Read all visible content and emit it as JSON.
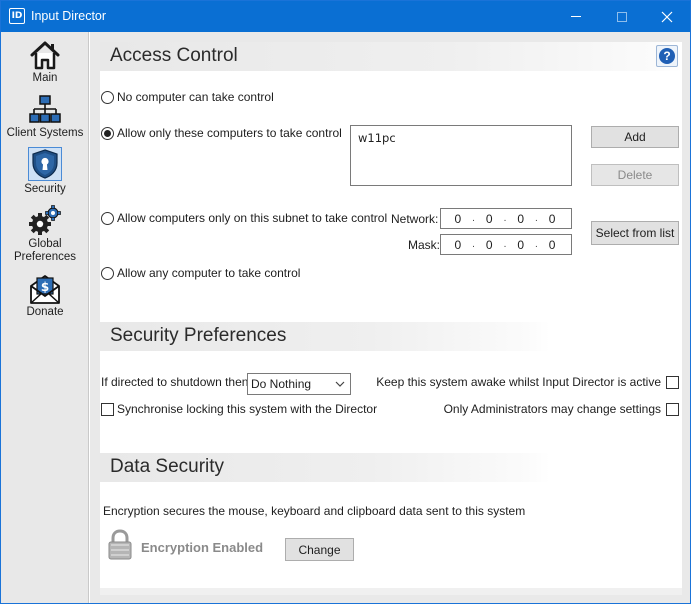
{
  "window": {
    "title": "Input Director",
    "icon_text": "ID"
  },
  "sidebar": {
    "items": [
      {
        "label": "Main",
        "icon": "home-icon"
      },
      {
        "label": "Client Systems",
        "icon": "network-icon"
      },
      {
        "label": "Security",
        "icon": "shield-lock-icon",
        "selected": true
      },
      {
        "label": "Global Preferences",
        "icon": "gears-icon"
      },
      {
        "label": "Donate",
        "icon": "donate-envelope-icon"
      }
    ]
  },
  "access_control": {
    "title": "Access Control",
    "help_label": "?",
    "options": [
      {
        "label": "No computer can take control",
        "checked": false
      },
      {
        "label": "Allow only these computers to take control",
        "checked": true
      },
      {
        "label": "Allow computers only on this subnet to take control",
        "checked": false
      },
      {
        "label": "Allow any computer to take control",
        "checked": false
      }
    ],
    "allowed_computers": [
      "w11pc"
    ],
    "add_label": "Add",
    "delete_label": "Delete",
    "network_label": "Network:",
    "mask_label": "Mask:",
    "network": [
      "0",
      "0",
      "0",
      "0"
    ],
    "mask": [
      "0",
      "0",
      "0",
      "0"
    ],
    "select_from_list_label": "Select from list"
  },
  "security_preferences": {
    "title": "Security Preferences",
    "shutdown_label": "If directed to shutdown then",
    "shutdown_value": "Do Nothing",
    "sync_lock_label": "Synchronise locking this system with the Director",
    "sync_lock_checked": false,
    "keep_awake_label": "Keep this system awake whilst Input Director is active",
    "keep_awake_checked": false,
    "admins_only_label": "Only Administrators may change settings",
    "admins_only_checked": false
  },
  "data_security": {
    "title": "Data Security",
    "description": "Encryption secures the mouse, keyboard and clipboard data sent to this system",
    "status": "Encryption Enabled",
    "change_label": "Change"
  },
  "colors": {
    "titlebar": "#0a6fd3",
    "sidebar_bg": "#e8e8e8",
    "selected_bg": "#cfe1f5",
    "help_blue": "#1f5fb5"
  }
}
